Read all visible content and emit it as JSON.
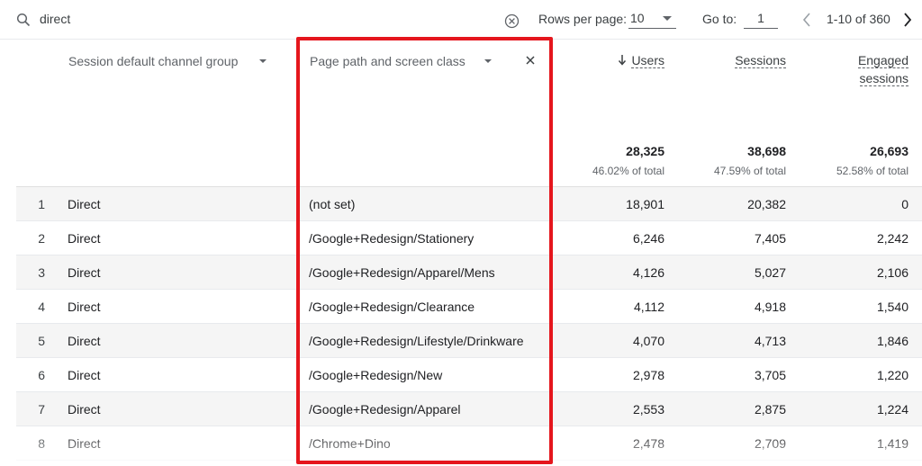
{
  "toolbar": {
    "search_value": "direct",
    "rows_per_page_label": "Rows per page:",
    "rows_per_page_value": "10",
    "goto_label": "Go to:",
    "goto_value": "1",
    "page_range": "1-10 of 360"
  },
  "columns": {
    "dim1": "Session default channel group",
    "dim2": "Page path and screen class",
    "users": "Users",
    "sessions": "Sessions",
    "engaged_line1": "Engaged",
    "engaged_line2": "sessions"
  },
  "totals": {
    "users": "28,325",
    "users_pct": "46.02% of total",
    "sessions": "38,698",
    "sessions_pct": "47.59% of total",
    "engaged": "26,693",
    "engaged_pct": "52.58% of total"
  },
  "rows": [
    {
      "idx": "1",
      "channel": "Direct",
      "path": "(not set)",
      "users": "18,901",
      "sessions": "20,382",
      "engaged": "0"
    },
    {
      "idx": "2",
      "channel": "Direct",
      "path": "/Google+Redesign/Stationery",
      "users": "6,246",
      "sessions": "7,405",
      "engaged": "2,242"
    },
    {
      "idx": "3",
      "channel": "Direct",
      "path": "/Google+Redesign/Apparel/Mens",
      "users": "4,126",
      "sessions": "5,027",
      "engaged": "2,106"
    },
    {
      "idx": "4",
      "channel": "Direct",
      "path": "/Google+Redesign/Clearance",
      "users": "4,112",
      "sessions": "4,918",
      "engaged": "1,540"
    },
    {
      "idx": "5",
      "channel": "Direct",
      "path": "/Google+Redesign/Lifestyle/Drinkware",
      "users": "4,070",
      "sessions": "4,713",
      "engaged": "1,846"
    },
    {
      "idx": "6",
      "channel": "Direct",
      "path": "/Google+Redesign/New",
      "users": "2,978",
      "sessions": "3,705",
      "engaged": "1,220"
    },
    {
      "idx": "7",
      "channel": "Direct",
      "path": "/Google+Redesign/Apparel",
      "users": "2,553",
      "sessions": "2,875",
      "engaged": "1,224"
    },
    {
      "idx": "8",
      "channel": "Direct",
      "path": "/Chrome+Dino",
      "users": "2,478",
      "sessions": "2,709",
      "engaged": "1,419"
    }
  ],
  "colors": {
    "highlight_border": "#e5161d",
    "row_alt_bg": "#f5f5f5"
  },
  "icons": {
    "search": "search-icon",
    "clear": "clear-circle-icon",
    "rows_dropdown": "caret-down-icon",
    "prev": "chevron-left-icon",
    "next": "chevron-right-icon",
    "sort": "arrow-down-icon",
    "remove_dimension": "close-icon"
  }
}
